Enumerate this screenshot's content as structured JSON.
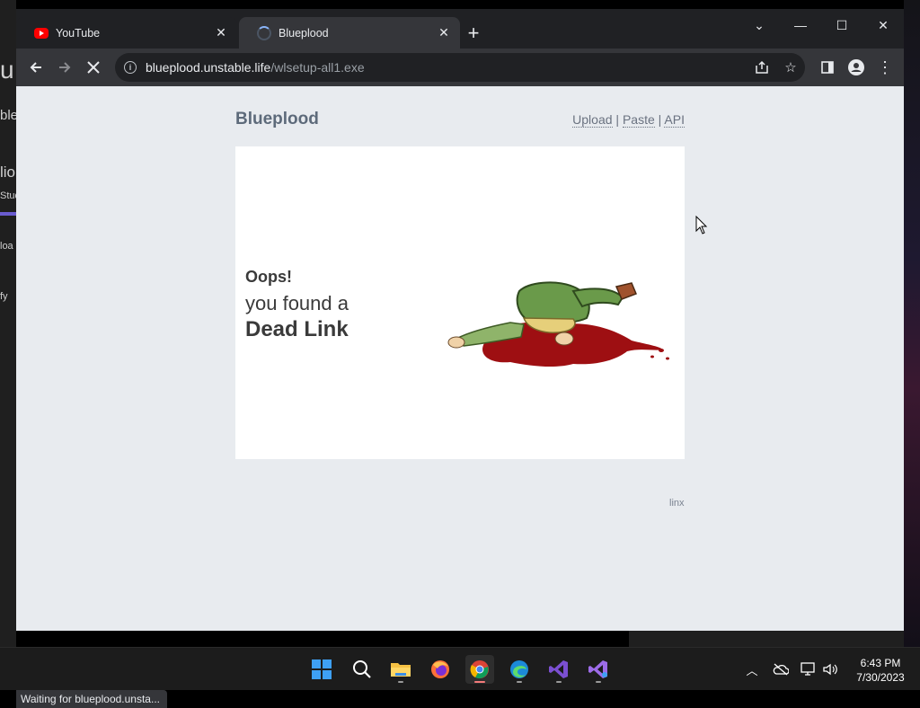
{
  "background_window": {
    "fragments": [
      "u",
      "ble",
      "lio",
      "Stud",
      "loa",
      "fy"
    ]
  },
  "tabs": [
    {
      "title": "YouTube",
      "icon": "youtube-icon",
      "active": false
    },
    {
      "title": "Blueplood",
      "icon": "loading-spinner-icon",
      "active": true
    }
  ],
  "address_bar": {
    "host": "blueplood.unstable.life",
    "path": "/wlsetup-all1.exe"
  },
  "page": {
    "site_title": "Blueplood",
    "nav": [
      "Upload",
      "Paste",
      "API"
    ],
    "nav_separator": "|",
    "error": {
      "line1": "Oops!",
      "line2": "you found a",
      "line3": "Dead Link"
    },
    "footer": "linx"
  },
  "status_bar": "Waiting for blueplood.unsta...",
  "taskbar": {
    "apps": [
      "start-icon",
      "search-icon",
      "file-explorer-icon",
      "firefox-icon",
      "chrome-icon",
      "edge-icon",
      "visual-studio-icon",
      "visual-studio-icon-2"
    ],
    "clock_time": "6:43 PM",
    "clock_date": "7/30/2023"
  },
  "colors": {
    "page_bg": "#e8ebef",
    "title": "#5d6a7a",
    "browser_bg": "#202124",
    "toolbar_bg": "#35363a"
  }
}
